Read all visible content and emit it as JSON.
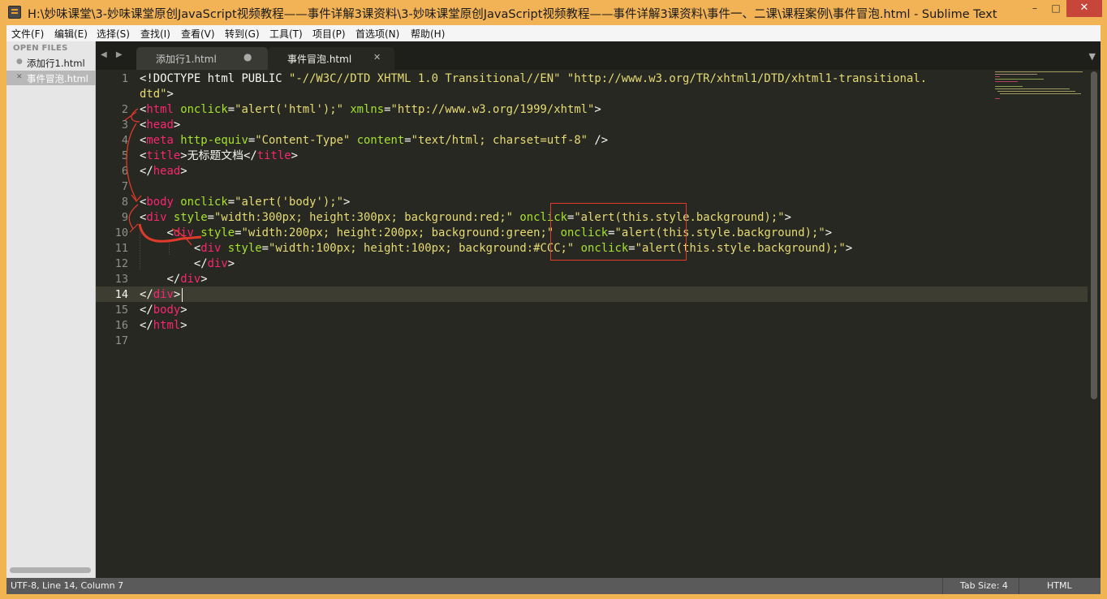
{
  "window": {
    "title": "H:\\妙味课堂\\3-妙味课堂原创JavaScript视频教程——事件详解3课资料\\3-妙味课堂原创JavaScript视频教程——事件详解3课资料\\事件一、二课\\课程案例\\事件冒泡.html - Sublime Text",
    "minimize": "–",
    "maximize": "□",
    "close": "✕"
  },
  "menu": [
    "文件(F)",
    "编辑(E)",
    "选择(S)",
    "查找(I)",
    "查看(V)",
    "转到(G)",
    "工具(T)",
    "项目(P)",
    "首选项(N)",
    "帮助(H)"
  ],
  "sidebar": {
    "heading": "OPEN FILES",
    "files": [
      {
        "name": "添加行1.html",
        "marker": "●"
      },
      {
        "name": "事件冒泡.html",
        "marker": "✕"
      }
    ]
  },
  "tabs": [
    {
      "label": "添加行1.html",
      "close": "●"
    },
    {
      "label": "事件冒泡.html",
      "close": "✕"
    }
  ],
  "tab_nav": "◀ ▶",
  "tab_dropdown": "▼",
  "editor": {
    "line_numbers": [
      "1",
      "",
      "2",
      "3",
      "4",
      "5",
      "6",
      "7",
      "8",
      "9",
      "10",
      "11",
      "12",
      "13",
      "14",
      "15",
      "16",
      "17"
    ],
    "current_line": "14"
  },
  "status": {
    "position": "UTF-8, Line 14, Column 7",
    "tab_size": "Tab Size: 4",
    "syntax": "HTML"
  },
  "colors": {
    "tag": "#f92672",
    "attribute": "#a6e22e",
    "string": "#e6db74",
    "text": "#f8f8f2",
    "annotation": "#e03a2a"
  }
}
